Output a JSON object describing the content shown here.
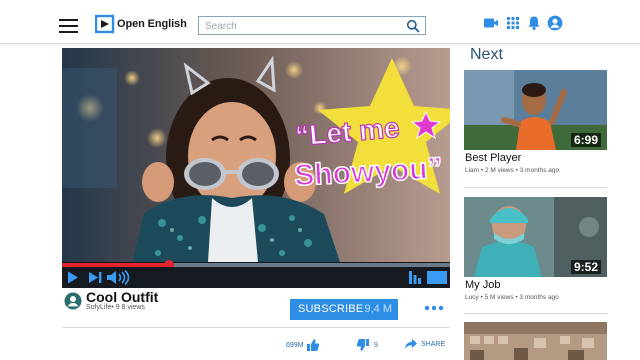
{
  "header": {
    "logo_text": "Open English",
    "search_placeholder": "Search"
  },
  "player": {
    "overlay_text_line1": "“Let me",
    "overlay_text_line2": "Showyou”",
    "progress_fraction": 0.275
  },
  "video": {
    "title": "Cool Outfit",
    "meta": "SofyLife• 9 8 views",
    "subscribe_label": "SUBSCRIBE",
    "subscriber_count": "9,4 M",
    "likes": "699M",
    "dislikes": "9",
    "share_label": "SHARE"
  },
  "sidebar": {
    "heading": "Next",
    "cards": [
      {
        "title": "Best Player",
        "meta": "Liam • 2 M views • 3 months ago",
        "duration": "6:99"
      },
      {
        "title": "My Job",
        "meta": "Lucy • 5 M views • 3 months ago",
        "duration": "9:52"
      }
    ]
  },
  "colors": {
    "accent": "#2e8ee6",
    "progress": "#e3242f",
    "overlay_star": "#f3df3c",
    "overlay_text": "#d63ad8"
  },
  "icons": [
    "menu-icon",
    "search-icon",
    "video-camera-icon",
    "apps-grid-icon",
    "bell-icon",
    "account-icon",
    "play-icon",
    "skip-next-icon",
    "volume-icon",
    "captions-icon",
    "fullscreen-icon",
    "thumbs-up-icon",
    "thumbs-down-icon",
    "share-icon",
    "more-dots-icon"
  ]
}
